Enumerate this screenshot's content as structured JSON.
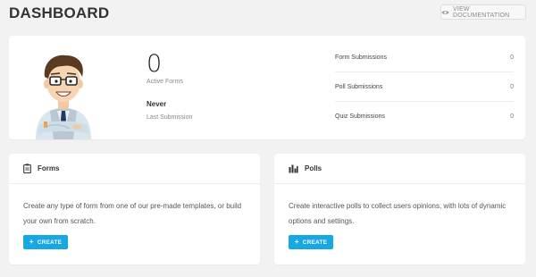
{
  "header": {
    "title": "DASHBOARD",
    "doc_button_label": "VIEW DOCUMENTATION",
    "doc_button_icon": "eye-icon"
  },
  "summary": {
    "active_forms_count": "0",
    "active_forms_label": "Active Forms",
    "last_submission_value": "Never",
    "last_submission_label": "Last Submission",
    "stats": [
      {
        "label": "Form Submissions",
        "value": "0"
      },
      {
        "label": "Poll Submissions",
        "value": "0"
      },
      {
        "label": "Quiz Submissions",
        "value": "0"
      }
    ]
  },
  "forms_card": {
    "title": "Forms",
    "icon": "clipboard-icon",
    "description": "Create any type of form from one of our pre-made templates, or build your own from scratch.",
    "button_icon": "+",
    "button_label": "CREATE"
  },
  "polls_card": {
    "title": "Polls",
    "icon": "bar-chart-icon",
    "description": "Create interactive polls to collect users opinions, with lots of dynamic options and settings.",
    "button_icon": "+",
    "button_label": "CREATE"
  },
  "colors": {
    "accent": "#17a8e3",
    "background": "#f2f2f2",
    "card": "#ffffff"
  }
}
